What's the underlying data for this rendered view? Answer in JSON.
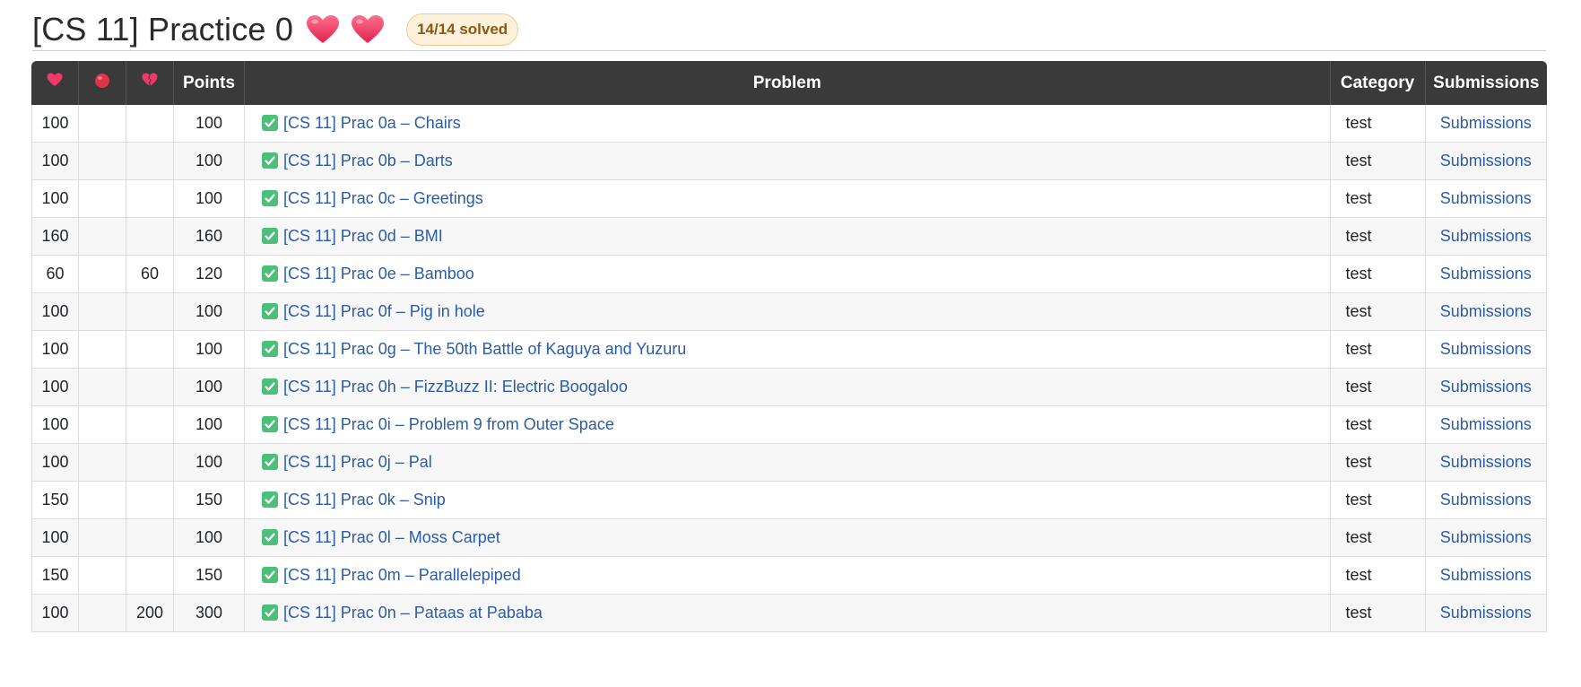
{
  "header": {
    "title": "[CS 11] Practice 0",
    "hearts": [
      "heart-icon",
      "heart-icon"
    ],
    "solved_badge": "14/14 solved"
  },
  "table": {
    "columns": {
      "heart": "heart-icon",
      "circle": "red-circle-icon",
      "broken": "broken-heart-icon",
      "points": "Points",
      "problem": "Problem",
      "category": "Category",
      "submissions": "Submissions"
    },
    "rows": [
      {
        "heart": "100",
        "circle": "",
        "broken": "",
        "points": "100",
        "problem": "[CS 11] Prac 0a – Chairs",
        "category": "test",
        "submissions": "Submissions"
      },
      {
        "heart": "100",
        "circle": "",
        "broken": "",
        "points": "100",
        "problem": "[CS 11] Prac 0b – Darts",
        "category": "test",
        "submissions": "Submissions"
      },
      {
        "heart": "100",
        "circle": "",
        "broken": "",
        "points": "100",
        "problem": "[CS 11] Prac 0c – Greetings",
        "category": "test",
        "submissions": "Submissions"
      },
      {
        "heart": "160",
        "circle": "",
        "broken": "",
        "points": "160",
        "problem": "[CS 11] Prac 0d – BMI",
        "category": "test",
        "submissions": "Submissions"
      },
      {
        "heart": "60",
        "circle": "",
        "broken": "60",
        "points": "120",
        "problem": "[CS 11] Prac 0e – Bamboo",
        "category": "test",
        "submissions": "Submissions"
      },
      {
        "heart": "100",
        "circle": "",
        "broken": "",
        "points": "100",
        "problem": "[CS 11] Prac 0f – Pig in hole",
        "category": "test",
        "submissions": "Submissions"
      },
      {
        "heart": "100",
        "circle": "",
        "broken": "",
        "points": "100",
        "problem": "[CS 11] Prac 0g – The 50th Battle of Kaguya and Yuzuru",
        "category": "test",
        "submissions": "Submissions"
      },
      {
        "heart": "100",
        "circle": "",
        "broken": "",
        "points": "100",
        "problem": "[CS 11] Prac 0h – FizzBuzz II: Electric Boogaloo",
        "category": "test",
        "submissions": "Submissions"
      },
      {
        "heart": "100",
        "circle": "",
        "broken": "",
        "points": "100",
        "problem": "[CS 11] Prac 0i – Problem 9 from Outer Space",
        "category": "test",
        "submissions": "Submissions"
      },
      {
        "heart": "100",
        "circle": "",
        "broken": "",
        "points": "100",
        "problem": "[CS 11] Prac 0j – Pal",
        "category": "test",
        "submissions": "Submissions"
      },
      {
        "heart": "150",
        "circle": "",
        "broken": "",
        "points": "150",
        "problem": "[CS 11] Prac 0k – Snip",
        "category": "test",
        "submissions": "Submissions"
      },
      {
        "heart": "100",
        "circle": "",
        "broken": "",
        "points": "100",
        "problem": "[CS 11] Prac 0l – Moss Carpet",
        "category": "test",
        "submissions": "Submissions"
      },
      {
        "heart": "150",
        "circle": "",
        "broken": "",
        "points": "150",
        "problem": "[CS 11] Prac 0m – Parallelepiped",
        "category": "test",
        "submissions": "Submissions"
      },
      {
        "heart": "100",
        "circle": "",
        "broken": "200",
        "points": "300",
        "problem": "[CS 11] Prac 0n – Pataas at Pababa",
        "category": "test",
        "submissions": "Submissions"
      }
    ]
  },
  "colors": {
    "header_bg": "#3a3a3a",
    "link": "#2a5caa",
    "check_green": "#4cbf7a",
    "heart_pink": "#f0386b",
    "circle_red": "#e0344a",
    "badge_bg": "#fdf1dc",
    "badge_text": "#8a5a12"
  }
}
